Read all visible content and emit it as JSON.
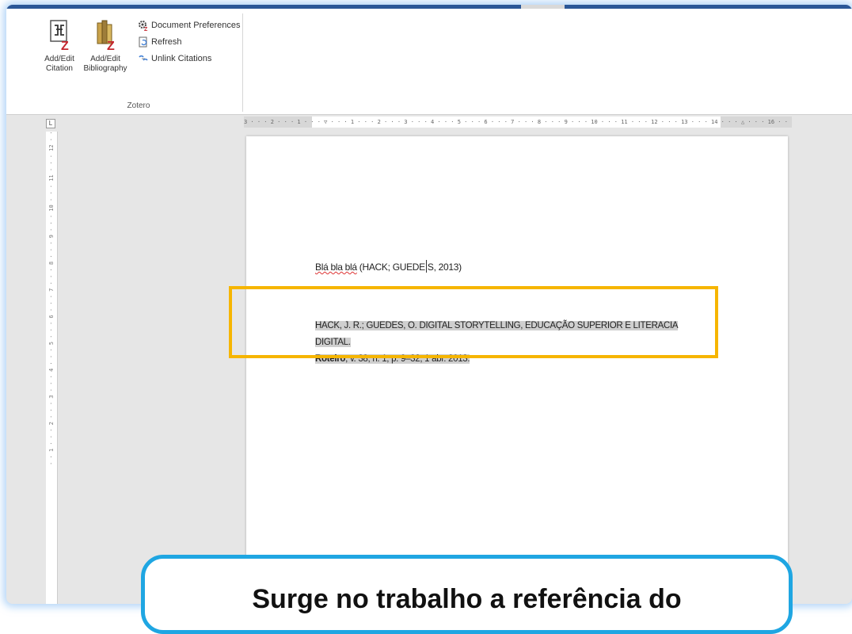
{
  "ribbon": {
    "group_label": "Zotero",
    "add_edit_citation": "Add/Edit\nCitation",
    "add_edit_bibliography": "Add/Edit\nBibliography",
    "document_preferences": "Document Preferences",
    "refresh": "Refresh",
    "unlink_citations": "Unlink Citations"
  },
  "ruler": {
    "tab_selector": "L",
    "horizontal_ticks": "3 · · · 2 · · · 1 · · · ▽ · · · 1 · · · 2 · · · 3 · · · 4 · · · 5 · · · 6 · · · 7 · · · 8 · · · 9 · · · 10 · · · 11 · · · 12 · · · 13 · · · 14 · · · △ · · · 16 · · · 17 · · ·",
    "vertical_ticks": "· · 1 · · · 2 · · · 3 · · · 4 · · · 5 · · · 6 · · · 7 · · · 8 · · · 9 · · · 10 · · · 11 · · · 12 · ·"
  },
  "document": {
    "citation_words": "Blá bla blá",
    "citation_ref_a": " (HACK; GUEDE",
    "citation_ref_b": "S, 2013)",
    "bib_line1": "HACK, J. R.; GUEDES, O. DIGITAL STORYTELLING, EDUCAÇÃO SUPERIOR E LITERACIA DIGITAL.",
    "bib_journal": "Roteiro",
    "bib_line2_rest": ", v. 38, n. 1, p. 9–32, 1 abr. 2013."
  },
  "caption": {
    "text": "Surge no trabalho a referência do"
  },
  "colors": {
    "highlight_box": "#f6b500",
    "caption_border": "#1fa6e2",
    "glow": "#78b4f0"
  }
}
